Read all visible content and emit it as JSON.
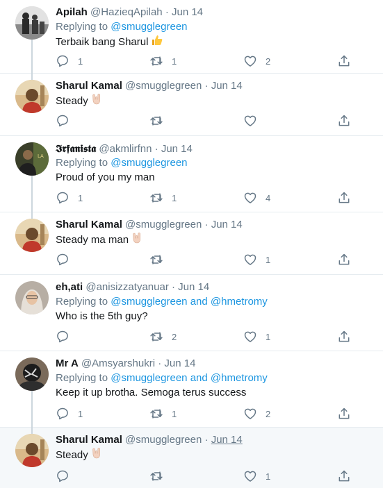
{
  "tweets": [
    {
      "name": "Apilah",
      "handle": "@HazieqApilah",
      "sep": "·",
      "date": "Jun 14",
      "replying_prefix": "Replying to",
      "replying_to": "@smugglegreen",
      "replying_and": "",
      "replying_to2": "",
      "text": "Terbaik bang Sharul",
      "emoji": "thumbs-up",
      "reply_count": "1",
      "retweet_count": "1",
      "like_count": "2"
    },
    {
      "name": "Sharul Kamal",
      "handle": "@smugglegreen",
      "sep": "·",
      "date": "Jun 14",
      "text": "Steady",
      "emoji": "rock-on-hand",
      "reply_count": "",
      "retweet_count": "",
      "like_count": ""
    },
    {
      "name": "𝕴𝖗𝖋𝖆𝖓𝖎𝖘𝖙𝖆",
      "handle": "@akmlirfnn",
      "sep": "·",
      "date": "Jun 14",
      "replying_prefix": "Replying to",
      "replying_to": "@smugglegreen",
      "text": "Proud of you my man",
      "reply_count": "1",
      "retweet_count": "1",
      "like_count": "4"
    },
    {
      "name": "Sharul Kamal",
      "handle": "@smugglegreen",
      "sep": "·",
      "date": "Jun 14",
      "text": "Steady ma man",
      "emoji": "rock-on-hand",
      "reply_count": "",
      "retweet_count": "",
      "like_count": "1"
    },
    {
      "name": "eh,ati",
      "handle": "@anisizzatyanuar",
      "sep": "·",
      "date": "Jun 14",
      "replying_prefix": "Replying to",
      "replying_to": "@smugglegreen",
      "replying_and": "and",
      "replying_to2": "@hmetromy",
      "text": "Who is the 5th guy?",
      "reply_count": "",
      "retweet_count": "2",
      "like_count": "1"
    },
    {
      "name": "Mr A",
      "handle": "@Amsyarshukri",
      "sep": "·",
      "date": "Jun 14",
      "replying_prefix": "Replying to",
      "replying_to": "@smugglegreen",
      "replying_and": "and",
      "replying_to2": "@hmetromy",
      "text": "Keep it up brotha. Semoga terus success",
      "reply_count": "1",
      "retweet_count": "1",
      "like_count": "2"
    },
    {
      "name": "Sharul Kamal",
      "handle": "@smugglegreen",
      "sep": "·",
      "date": "Jun 14",
      "text": "Steady",
      "emoji": "rock-on-hand",
      "reply_count": "",
      "retweet_count": "",
      "like_count": "1"
    }
  ],
  "colors": {
    "link": "#1b95e0",
    "muted": "#657786",
    "thread_line": "#ccd6dd",
    "highlight_bg": "#f5f8fa"
  }
}
